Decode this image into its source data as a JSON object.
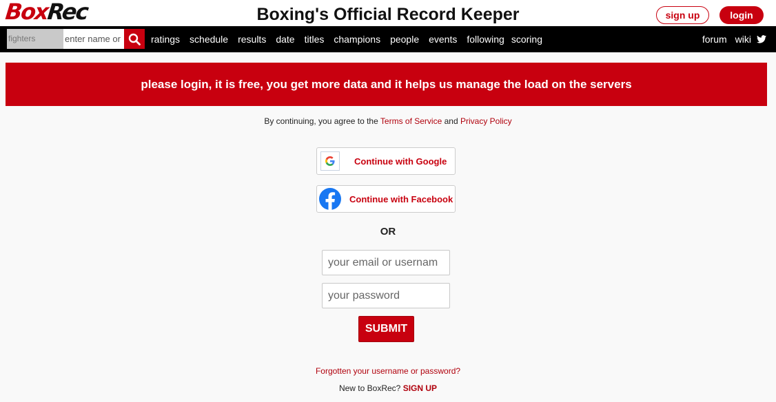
{
  "header": {
    "logo_part1": "Box",
    "logo_part2": "Rec",
    "title": "Boxing's Official Record Keeper",
    "signup_label": "sign up",
    "login_label": "login"
  },
  "nav": {
    "search_category": "fighters",
    "search_placeholder": "enter name or",
    "items": [
      {
        "label": "ratings"
      },
      {
        "label": "schedule"
      },
      {
        "label": "results"
      },
      {
        "label": "date"
      },
      {
        "label": "titles"
      },
      {
        "label": "champions"
      },
      {
        "label": "people"
      },
      {
        "label": "events"
      },
      {
        "label": "following"
      },
      {
        "label": "scoring"
      }
    ],
    "right_items": [
      {
        "label": "forum"
      },
      {
        "label": "wiki"
      }
    ],
    "twitter_icon": "twitter-icon"
  },
  "banner": {
    "text": "please login, it is free, you get more data and it helps us manage the load on the servers"
  },
  "agreement": {
    "prefix": "By continuing, you agree to the",
    "terms_link": "Terms of Service",
    "and": "and",
    "privacy_link": "Privacy Policy"
  },
  "social": {
    "google_label": "Continue with Google",
    "facebook_label": "Continue with Facebook"
  },
  "or_label": "OR",
  "form": {
    "email_placeholder": "your email or usernam",
    "password_placeholder": "your password",
    "submit_label": "SUBMIT"
  },
  "footer": {
    "forgot_link": "Forgotten your username or password?",
    "new_prefix": "New to BoxRec?",
    "signup_link": "SIGN UP"
  },
  "colors": {
    "brand_red": "#c8000f",
    "nav_bg": "#000000"
  }
}
